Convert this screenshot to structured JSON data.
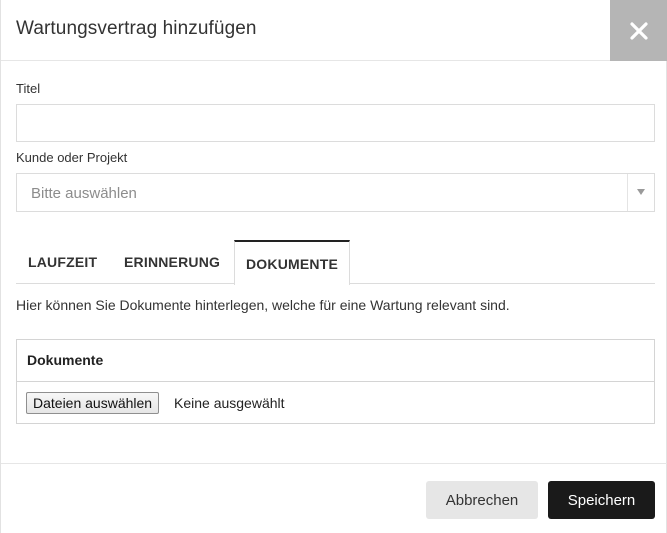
{
  "dialog": {
    "title": "Wartungsvertrag hinzufügen"
  },
  "form": {
    "title_label": "Titel",
    "title_value": "",
    "customer_label": "Kunde oder Projekt",
    "customer_placeholder": "Bitte auswählen"
  },
  "tabs": [
    {
      "label": "LAUFZEIT",
      "active": false
    },
    {
      "label": "ERINNERUNG",
      "active": false
    },
    {
      "label": "DOKUMENTE",
      "active": true
    }
  ],
  "documents": {
    "info_text": "Hier können Sie Dokumente hinterlegen, welche für eine Wartung relevant sind.",
    "panel_title": "Dokumente",
    "file_button_label": "Dateien auswählen",
    "file_status": "Keine ausgewählt"
  },
  "footer": {
    "cancel_label": "Abbrechen",
    "save_label": "Speichern"
  },
  "icons": {
    "close": "close-icon",
    "dropdown": "chevron-down-icon"
  },
  "colors": {
    "close_button_bg": "#b5b5b5",
    "save_button_bg": "#1a1a1a",
    "cancel_button_bg": "#e6e6e6",
    "active_tab_border": "#222222"
  }
}
